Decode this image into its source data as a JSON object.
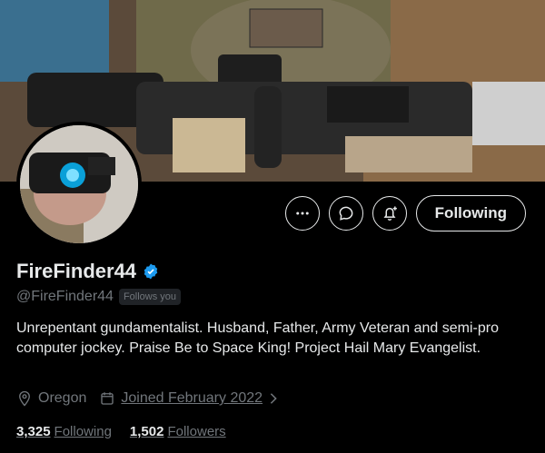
{
  "profile": {
    "display_name": "FireFinder44",
    "handle": "@FireFinder44",
    "follows_you": "Follows you",
    "verified": true,
    "bio": "Unrepentant gundamentalist. Husband, Father, Army Veteran and semi-pro computer jockey. Praise Be to Space King! Project Hail Mary Evangelist.",
    "location": "Oregon",
    "joined": "Joined February 2022"
  },
  "actions": {
    "more_icon": "more-horizontal-icon",
    "message_icon": "message-icon",
    "notify_icon": "bell-plus-icon",
    "following_label": "Following"
  },
  "stats": {
    "following_count": "3,325",
    "following_label": "Following",
    "followers_count": "1,502",
    "followers_label": "Followers"
  },
  "colors": {
    "background": "#000000",
    "text_primary": "#e7e9ea",
    "text_secondary": "#71767b",
    "verified_badge": "#1d9bf0"
  }
}
